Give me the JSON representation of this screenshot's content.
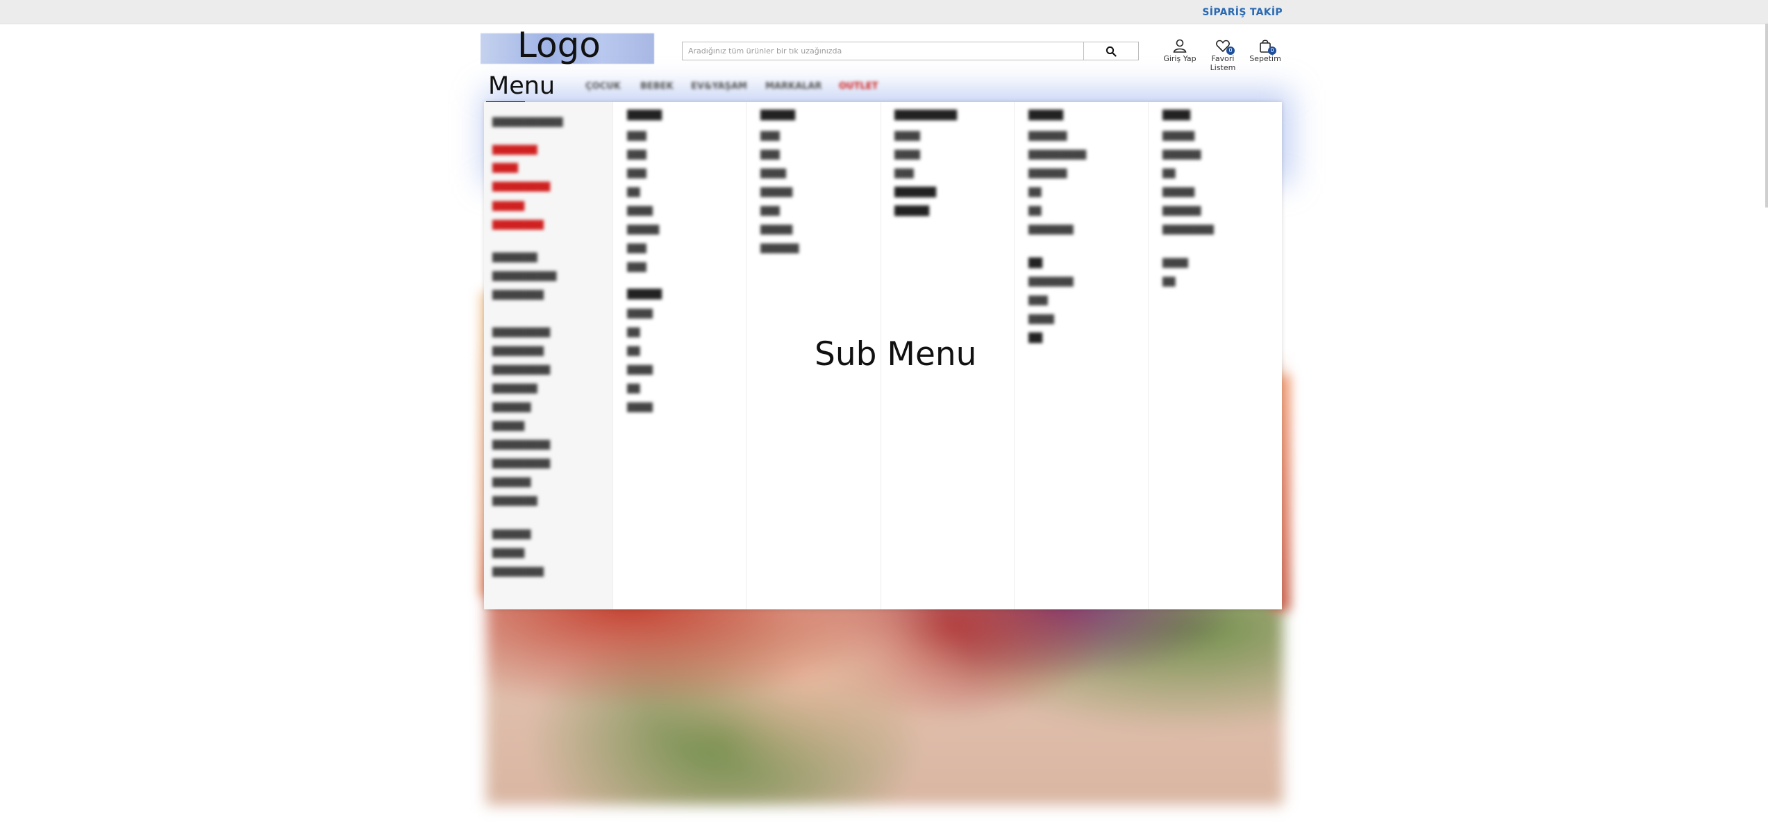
{
  "topbar": {
    "order_track": "SİPARİŞ TAKİP"
  },
  "header": {
    "logo_label": "Logo",
    "search_placeholder": "Aradığınız tüm ürünler bir tık uzağınızda",
    "actions": [
      {
        "label": "Giriş Yap",
        "icon": "user-icon"
      },
      {
        "label": "Favori Listem",
        "icon": "heart-icon",
        "count": "0"
      },
      {
        "label": "Sepetim",
        "icon": "bag-icon",
        "count": "0"
      }
    ]
  },
  "nav": {
    "label": "Menu",
    "items": [
      {
        "label": "ÇOCUK"
      },
      {
        "label": "BEBEK"
      },
      {
        "label": "EV&YAŞAM"
      },
      {
        "label": "MARKALAR"
      },
      {
        "label": "OUTLET"
      }
    ]
  },
  "submenu": {
    "label": "Sub Menu"
  },
  "colors": {
    "accent": "#2a6ab3",
    "badge": "#1f4f9b",
    "sale": "#d02020"
  }
}
